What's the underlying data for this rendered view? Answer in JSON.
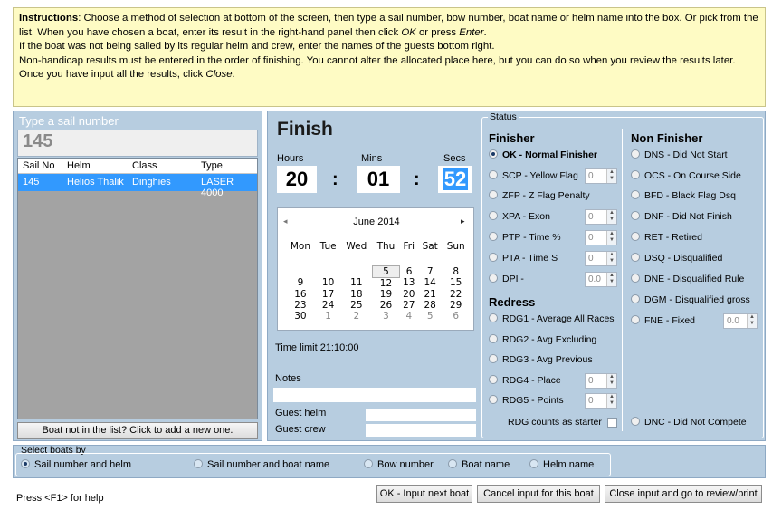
{
  "instructions": {
    "l1_bold": "Instructions",
    "l1_a": ": Choose a method of selection at bottom of the screen, then type a sail number, bow number, boat name or helm name into the box. Or pick from the list. When you have chosen a boat, enter its result in the right-hand panel then click ",
    "l1_ok": "OK",
    "l1_b": " or press ",
    "l1_enter": "Enter",
    "l1_c": ".",
    "l2": "If the boat was not being sailed by its regular helm and crew, enter the names of the guests bottom right.",
    "l3": "Non-handicap results must be entered in the order of finishing. You cannot alter the allocated place here, but you can do so when you review the results later.",
    "l4_a": "Once you have input all the results, click ",
    "l4_close": "Close",
    "l4_b": "."
  },
  "left": {
    "type_label": "Type a sail number",
    "sail_value": "145",
    "columns": [
      "Sail No",
      "Helm",
      "Class",
      "Type"
    ],
    "row": {
      "sail_no": "145",
      "helm": "Helios Thalik",
      "class": "Dinghies",
      "type": "LASER 4000"
    },
    "add_button": "Boat not in the list? Click to add a new one."
  },
  "finish": {
    "title": "Finish",
    "hours_label": "Hours",
    "mins_label": "Mins",
    "secs_label": "Secs",
    "hours": "20",
    "mins": "01",
    "secs": "52",
    "colon": ":",
    "time_limit": "Time limit 21:10:00",
    "notes_label": "Notes",
    "guest_helm_label": "Guest helm",
    "guest_crew_label": "Guest crew"
  },
  "calendar": {
    "prev": "◂",
    "next": "▸",
    "month": "June 2014",
    "weekdays": [
      "Mon",
      "Tue",
      "Wed",
      "Thu",
      "Fri",
      "Sat",
      "Sun"
    ],
    "weeks": [
      [
        "",
        "",
        "",
        "",
        "",
        "",
        ""
      ],
      [
        "",
        "",
        "",
        "5",
        "6",
        "7",
        "8"
      ],
      [
        "9",
        "10",
        "11",
        "12",
        "13",
        "14",
        "15"
      ],
      [
        "16",
        "17",
        "18",
        "19",
        "20",
        "21",
        "22"
      ],
      [
        "23",
        "24",
        "25",
        "26",
        "27",
        "28",
        "29"
      ],
      [
        "30",
        "1",
        "2",
        "3",
        "4",
        "5",
        "6"
      ]
    ]
  },
  "status": {
    "legend": "Status",
    "finisher_heading": "Finisher",
    "finisher": [
      {
        "label": "OK - Normal Finisher",
        "selected": true
      },
      {
        "label": "SCP - Yellow Flag",
        "spin": "0"
      },
      {
        "label": "ZFP - Z Flag Penalty"
      },
      {
        "label": "XPA - Exon",
        "spin": "0"
      },
      {
        "label": "PTP - Time %",
        "spin": "0"
      },
      {
        "label": "PTA - Time S",
        "spin": "0"
      },
      {
        "label": "DPI -",
        "spin": "0.0"
      }
    ],
    "redress_heading": "Redress",
    "redress": [
      {
        "label": "RDG1 - Average All Races"
      },
      {
        "label": "RDG2 - Avg Excluding"
      },
      {
        "label": "RDG3 - Avg Previous"
      },
      {
        "label": "RDG4 - Place",
        "spin": "0"
      },
      {
        "label": "RDG5 - Points",
        "spin": "0"
      }
    ],
    "rdg_starter_label": "RDG counts as starter",
    "nonfinisher_heading": "Non Finisher",
    "nonfinisher": [
      {
        "label": "DNS - Did Not Start"
      },
      {
        "label": "OCS - On Course Side"
      },
      {
        "label": "BFD - Black Flag Dsq"
      },
      {
        "label": "DNF - Did Not Finish"
      },
      {
        "label": "RET - Retired"
      },
      {
        "label": "DSQ - Disqualified"
      },
      {
        "label": "DNE - Disqualified Rule"
      },
      {
        "label": "DGM - Disqualified gross"
      },
      {
        "label": "FNE - Fixed",
        "spin": "0.0"
      }
    ],
    "dnc_label": "DNC - Did Not Compete"
  },
  "select_by": {
    "legend": "Select boats by",
    "options": [
      {
        "label": "Sail number and helm",
        "selected": true
      },
      {
        "label": "Sail number and boat name"
      },
      {
        "label": "Bow number"
      },
      {
        "label": "Boat name"
      },
      {
        "label": "Helm name"
      }
    ]
  },
  "bottom": {
    "help": "Press <F1> for help",
    "ok_button": "OK - Input next boat",
    "cancel_button": "Cancel input for this boat",
    "close_button": "Close input and go to review/print"
  },
  "colors": {
    "panel": "#b7cde0",
    "instructions_bg": "#fefbc4",
    "selection": "#3299fe"
  }
}
